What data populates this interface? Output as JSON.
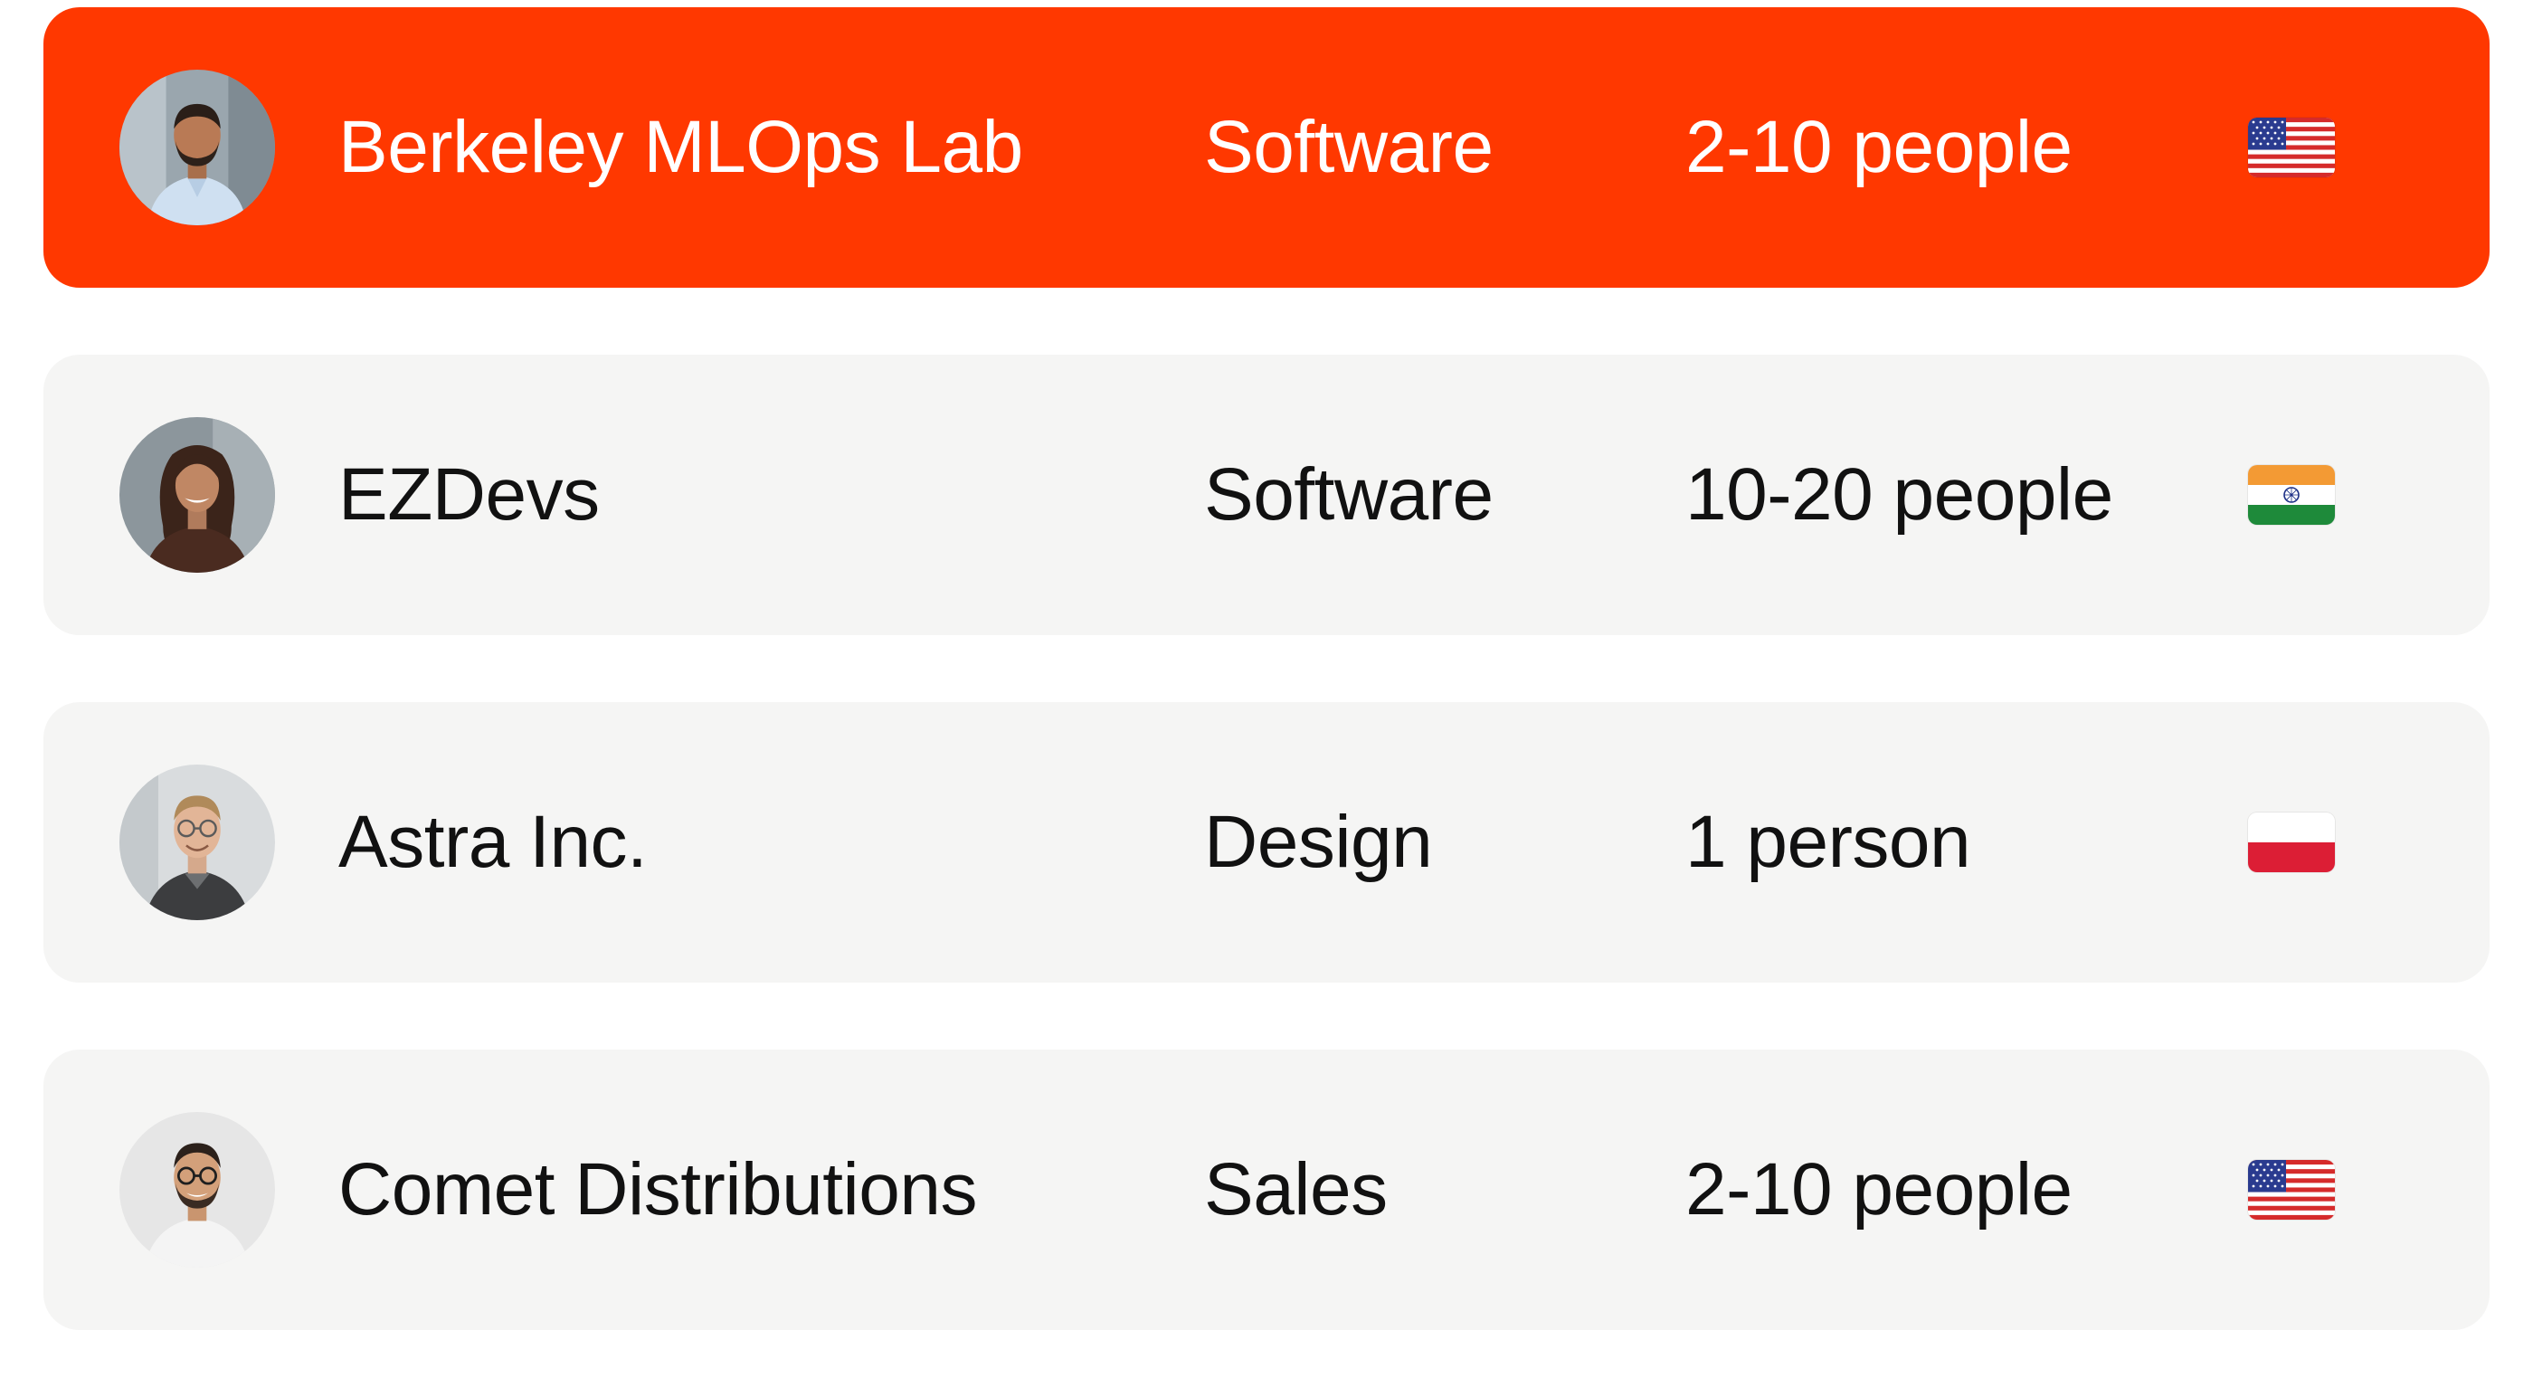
{
  "companies": [
    {
      "name": "Berkeley MLOps Lab",
      "industry": "Software",
      "size": "2-10 people",
      "flag_icon": "us-flag-icon",
      "avatar": "man-beard-portrait",
      "selected": true
    },
    {
      "name": "EZDevs",
      "industry": "Software",
      "size": "10-20 people",
      "flag_icon": "india-flag-icon",
      "avatar": "woman-portrait",
      "selected": false
    },
    {
      "name": "Astra Inc.",
      "industry": "Design",
      "size": "1 person",
      "flag_icon": "poland-flag-icon",
      "avatar": "man-glasses-portrait",
      "selected": false
    },
    {
      "name": "Comet Distributions",
      "industry": "Sales",
      "size": "2-10 people",
      "flag_icon": "us-flag-icon",
      "avatar": "man-glasses-beard-portrait",
      "selected": false
    }
  ],
  "colors": {
    "selected_row": "#ff3800",
    "row": "#f5f5f4",
    "text": "#111111",
    "selected_text": "#ffffff"
  }
}
